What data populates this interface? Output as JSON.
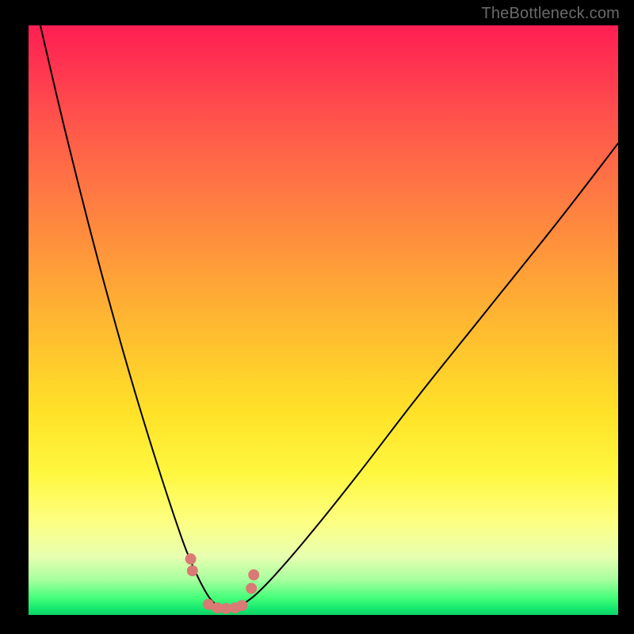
{
  "watermark": "TheBottleneck.com",
  "chart_data": {
    "type": "line",
    "title": "",
    "xlabel": "",
    "ylabel": "",
    "xlim": [
      0,
      100
    ],
    "ylim": [
      0,
      100
    ],
    "grid": false,
    "series": [
      {
        "name": "bottleneck-curve",
        "x": [
          2,
          6,
          10,
          14,
          18,
          22,
          26,
          28,
          30,
          31.5,
          33,
          35,
          38,
          42,
          48,
          56,
          66,
          78,
          90,
          100
        ],
        "y": [
          100,
          83,
          67,
          52,
          38,
          25,
          13,
          8,
          4,
          2,
          1,
          1.2,
          3,
          7,
          14,
          24,
          37,
          52,
          67,
          80
        ]
      }
    ],
    "markers": {
      "name": "highlight-dots",
      "x": [
        27.5,
        27.8,
        30.5,
        32,
        33.5,
        35,
        36.2,
        37.8,
        38.2
      ],
      "y": [
        9.5,
        7.5,
        1.8,
        1.2,
        1.1,
        1.2,
        1.6,
        4.5,
        6.8
      ]
    },
    "gradient_stops": [
      {
        "pos": 0,
        "color": "#ff1e53"
      },
      {
        "pos": 18,
        "color": "#ff5a4a"
      },
      {
        "pos": 42,
        "color": "#ffa038"
      },
      {
        "pos": 66,
        "color": "#ffe328"
      },
      {
        "pos": 84,
        "color": "#fdff80"
      },
      {
        "pos": 94,
        "color": "#a8ff9f"
      },
      {
        "pos": 100,
        "color": "#0fcf64"
      }
    ]
  }
}
